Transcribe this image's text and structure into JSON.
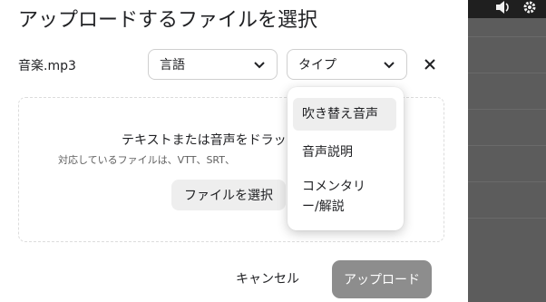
{
  "dialog": {
    "title": "アップロードするファイルを選択",
    "file_name": "音楽.mp3",
    "language_select": {
      "value": "言語"
    },
    "type_select": {
      "value": "タイプ"
    },
    "dropzone": {
      "title": "テキストまたは音声をドラッグ",
      "subtitle": "対応しているファイルは、VTT、SRT、",
      "choose_button": "ファイルを選択"
    },
    "cancel_button": "キャンセル",
    "upload_button": "アップロード"
  },
  "type_menu": {
    "items": [
      {
        "label": "吹き替え音声",
        "highlighted": true
      },
      {
        "label": "音声説明",
        "highlighted": false
      },
      {
        "label_line1": "コメンタリ",
        "label_line2": "ー/解説",
        "highlighted": false
      }
    ]
  },
  "background": {
    "icons": [
      "volume-icon",
      "gear-icon"
    ],
    "colors": {
      "overlay": "#5c5c5c",
      "upload_button": "#8d8d8d"
    }
  }
}
